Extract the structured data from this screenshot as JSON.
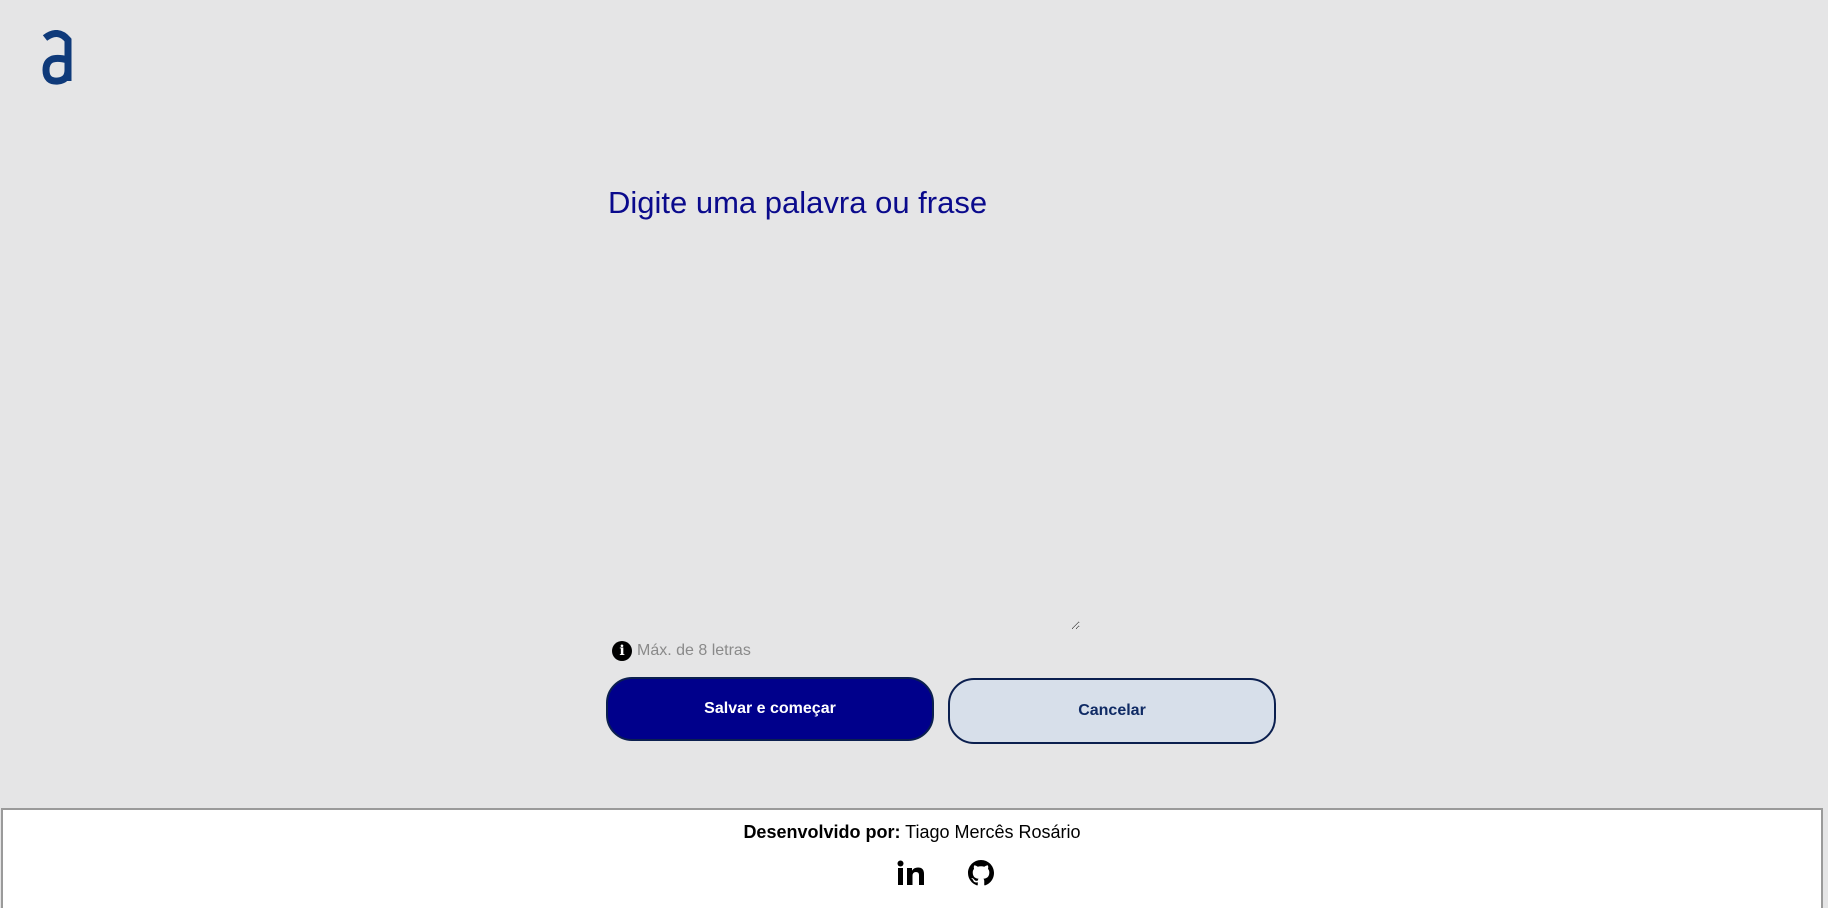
{
  "header": {
    "logo_icon": "letter-a-logo",
    "brand_color": "#0f3a7a"
  },
  "main": {
    "title": "Digite uma palavra ou frase",
    "input": {
      "value": "",
      "placeholder": ""
    },
    "hint": {
      "icon": "info-icon",
      "text": "Máx. de 8 letras"
    },
    "primary_button": "Salvar e começar",
    "secondary_button": "Cancelar",
    "accent_color": "#00008b"
  },
  "footer": {
    "credit_label": "Desenvolvido por:",
    "credit_name": "Tiago Mercês Rosário",
    "links": [
      {
        "icon": "linkedin-icon"
      },
      {
        "icon": "github-icon"
      }
    ]
  }
}
